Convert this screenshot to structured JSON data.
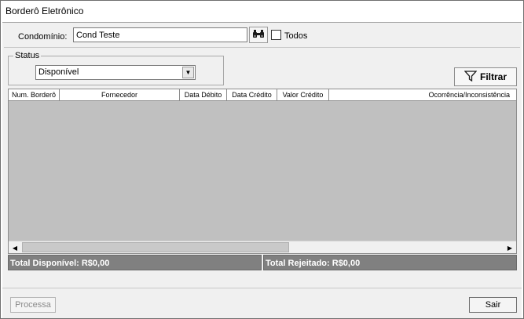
{
  "window": {
    "title": "Borderô Eletrônico"
  },
  "filter": {
    "condominio_label": "Condomínio:",
    "condominio_value": "Cond Teste",
    "todos_label": "Todos",
    "todos_checked": false
  },
  "status": {
    "legend": "Status",
    "selected": "Disponível"
  },
  "buttons": {
    "filtrar": "Filtrar",
    "processa": "Processa",
    "sair": "Sair"
  },
  "table": {
    "columns": [
      "Num. Borderô",
      "Fornecedor",
      "Data Débito",
      "Data Crédito",
      "Valor Crédito",
      "Ocorrência/Inconsistência"
    ],
    "rows": []
  },
  "totals": {
    "disponivel": "Total Disponível: R$0,00",
    "rejeitado": "Total Rejeitado: R$0,00"
  }
}
